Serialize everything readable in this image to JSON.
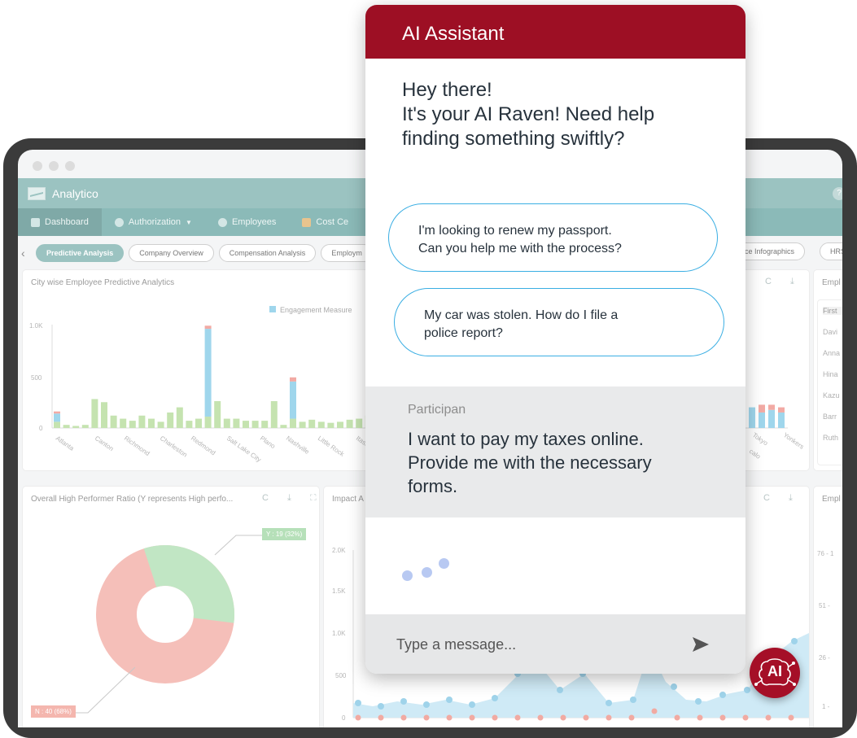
{
  "dashboard": {
    "app_name": "Analytico",
    "help_glyph": "?",
    "nav": [
      {
        "label": "Dashboard",
        "icon": "dashboard-icon"
      },
      {
        "label": "Authorization",
        "icon": "lock-icon"
      },
      {
        "label": "Employees",
        "icon": "employees-icon"
      },
      {
        "label": "Cost Ce",
        "icon": "gift-icon"
      }
    ],
    "tabs": [
      "Predictive Analysis",
      "Company Overview",
      "Compensation Analysis",
      "Employm"
    ],
    "tabs_right": [
      "ance Infographics",
      "HRS"
    ],
    "card1": {
      "title": "City wise Employee Predictive Analytics",
      "legend": "Engagement Measure",
      "y_ticks": [
        "1.0K",
        "500",
        "0"
      ],
      "cities": [
        "Atlanta",
        "Canton",
        "Richmond",
        "Charleston",
        "Redmond",
        "Salt Lake City",
        "Plano",
        "Nashville",
        "Little Rock",
        "Itasca",
        "R"
      ],
      "cities_right": [
        "Tokyo",
        "Yonkers",
        "calo"
      ]
    },
    "card_right_top": {
      "title": "Empl",
      "rows": [
        "First",
        "Davi",
        "Anna",
        "Hina",
        "Kazu",
        "Barr",
        "Ruth"
      ]
    },
    "card2": {
      "title": "Overall High Performer Ratio (Y represents High perfo...",
      "label_y": "Y : 19 (32%)",
      "label_n": "N : 40 (68%)"
    },
    "card3": {
      "title": "Impact A",
      "y_ticks": [
        "2.0K",
        "1.5K",
        "1.0K",
        "500",
        "0"
      ]
    },
    "card_right_bottom": {
      "title": "Empl",
      "ticks": [
        "76 - 1",
        "51 -",
        "26 -",
        "1 -"
      ]
    },
    "tool_glyphs": "C ⤓ ⛶"
  },
  "chart_data": {
    "type": "bar",
    "title": "City wise Employee Predictive Analytics",
    "ylim": [
      0,
      1000
    ],
    "legend": [
      "Engagement Measure"
    ],
    "series": [
      {
        "name": "Engagement Measure",
        "values": [
          80,
          0,
          0,
          0,
          0,
          0,
          0,
          0,
          0,
          0,
          0,
          0,
          0,
          0,
          0,
          0,
          850,
          0,
          0,
          0,
          0,
          0,
          0,
          0,
          0,
          360,
          0,
          0,
          0,
          0,
          0,
          0,
          0,
          0,
          0,
          250,
          0,
          0,
          0
        ]
      },
      {
        "name": "",
        "values": [
          60,
          30,
          20,
          30,
          280,
          250,
          120,
          90,
          70,
          120,
          90,
          60,
          150,
          200,
          70,
          90,
          110,
          260,
          90,
          90,
          70,
          70,
          70,
          260,
          30,
          90,
          60,
          80,
          60,
          50,
          60,
          80,
          90,
          120,
          40,
          90,
          190,
          70,
          80
        ]
      },
      {
        "name": "",
        "values": [
          20,
          0,
          0,
          0,
          0,
          0,
          0,
          0,
          0,
          0,
          0,
          0,
          0,
          0,
          0,
          0,
          30,
          0,
          0,
          0,
          0,
          0,
          0,
          0,
          0,
          40,
          0,
          0,
          0,
          0,
          0,
          0,
          0,
          0,
          0,
          80,
          0,
          0,
          0
        ]
      }
    ]
  },
  "chat": {
    "header": "AI Assistant",
    "greeting": [
      "Hey there!",
      "It's your AI Raven! Need help",
      "finding something swiftly?"
    ],
    "suggestions": [
      [
        "I'm looking to renew my passport.",
        "Can you help me with the process?"
      ],
      [
        "My car was stolen. How do I file a",
        "police report?"
      ]
    ],
    "message": {
      "sender": "Participan",
      "text": [
        "I want to pay my taxes online.",
        "Provide me with the necessary",
        "forms."
      ]
    },
    "input_placeholder": "Type a message...",
    "fab_label": "AI",
    "accent": "#9d0f24",
    "suggestion_border": "#3aaee3"
  }
}
